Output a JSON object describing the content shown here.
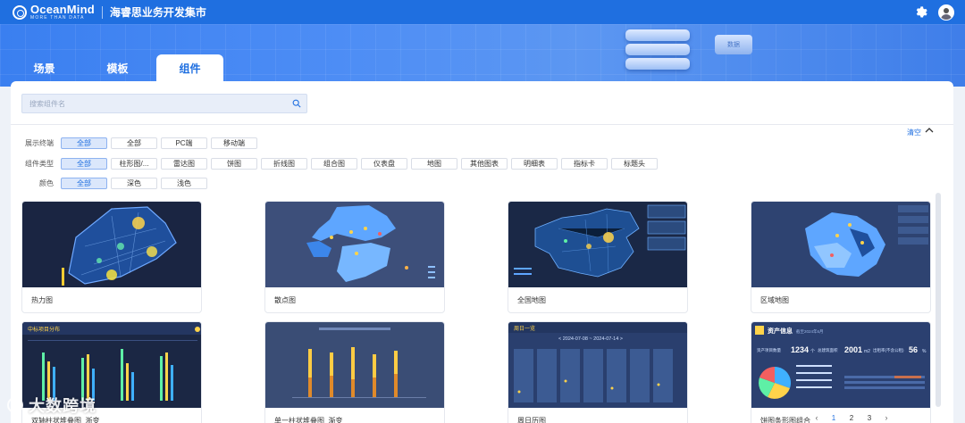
{
  "header": {
    "logo_name": "OceanMind",
    "logo_sub": "MORE THAN DATA",
    "title": "海睿思业务开发集市",
    "icons": [
      "gear-icon",
      "avatar"
    ]
  },
  "banner": {
    "server_badge": "数据"
  },
  "tabs": [
    {
      "label": "场景",
      "active": false
    },
    {
      "label": "模板",
      "active": false
    },
    {
      "label": "组件",
      "active": true
    }
  ],
  "search": {
    "placeholder": "搜索组件名"
  },
  "filter_bar": {
    "clear_label": "清空"
  },
  "filters": {
    "display": {
      "label": "展示终端",
      "options": [
        "全部",
        "全部",
        "PC端",
        "移动端"
      ],
      "selected": 0
    },
    "type": {
      "label": "组件类型",
      "options": [
        "全部",
        "柱形图/...",
        "雷达图",
        "饼图",
        "折线图",
        "组合图",
        "仪表盘",
        "地图",
        "其他图表",
        "明细表",
        "指标卡",
        "标题头"
      ],
      "selected": 0
    },
    "color": {
      "label": "颜色",
      "options": [
        "全部",
        "深色",
        "浅色"
      ],
      "selected": 0
    }
  },
  "cards": [
    {
      "label": "热力图"
    },
    {
      "label": "散点图"
    },
    {
      "label": "全国地图"
    },
    {
      "label": "区域地图"
    },
    {
      "label": "双轴柱状堆叠图_浙变",
      "thumb_title": "中标项目分布"
    },
    {
      "label": "单一柱状堆叠图_渐变"
    },
    {
      "label": "周日历图",
      "thumb_title": "周日一览",
      "thumb_date": "< 2024-07-08 ~ 2024-07-14 >"
    },
    {
      "label": "饼图条形图组合",
      "thumb_title": "资产信息",
      "thumb_date": "截至2024年6月",
      "thumb_stats": [
        "1234",
        "2001",
        "56"
      ],
      "thumb_stat_units": [
        "个",
        "m2",
        "%"
      ],
      "thumb_stat_labels": [
        "资产项目数量",
        "总建筑面积",
        "出租率(不含公租)"
      ]
    }
  ],
  "pagination": {
    "pages": [
      "1",
      "2",
      "3"
    ],
    "current": "1",
    "prev": "‹",
    "next": "›"
  },
  "watermark": {
    "text": "大数跨境"
  }
}
